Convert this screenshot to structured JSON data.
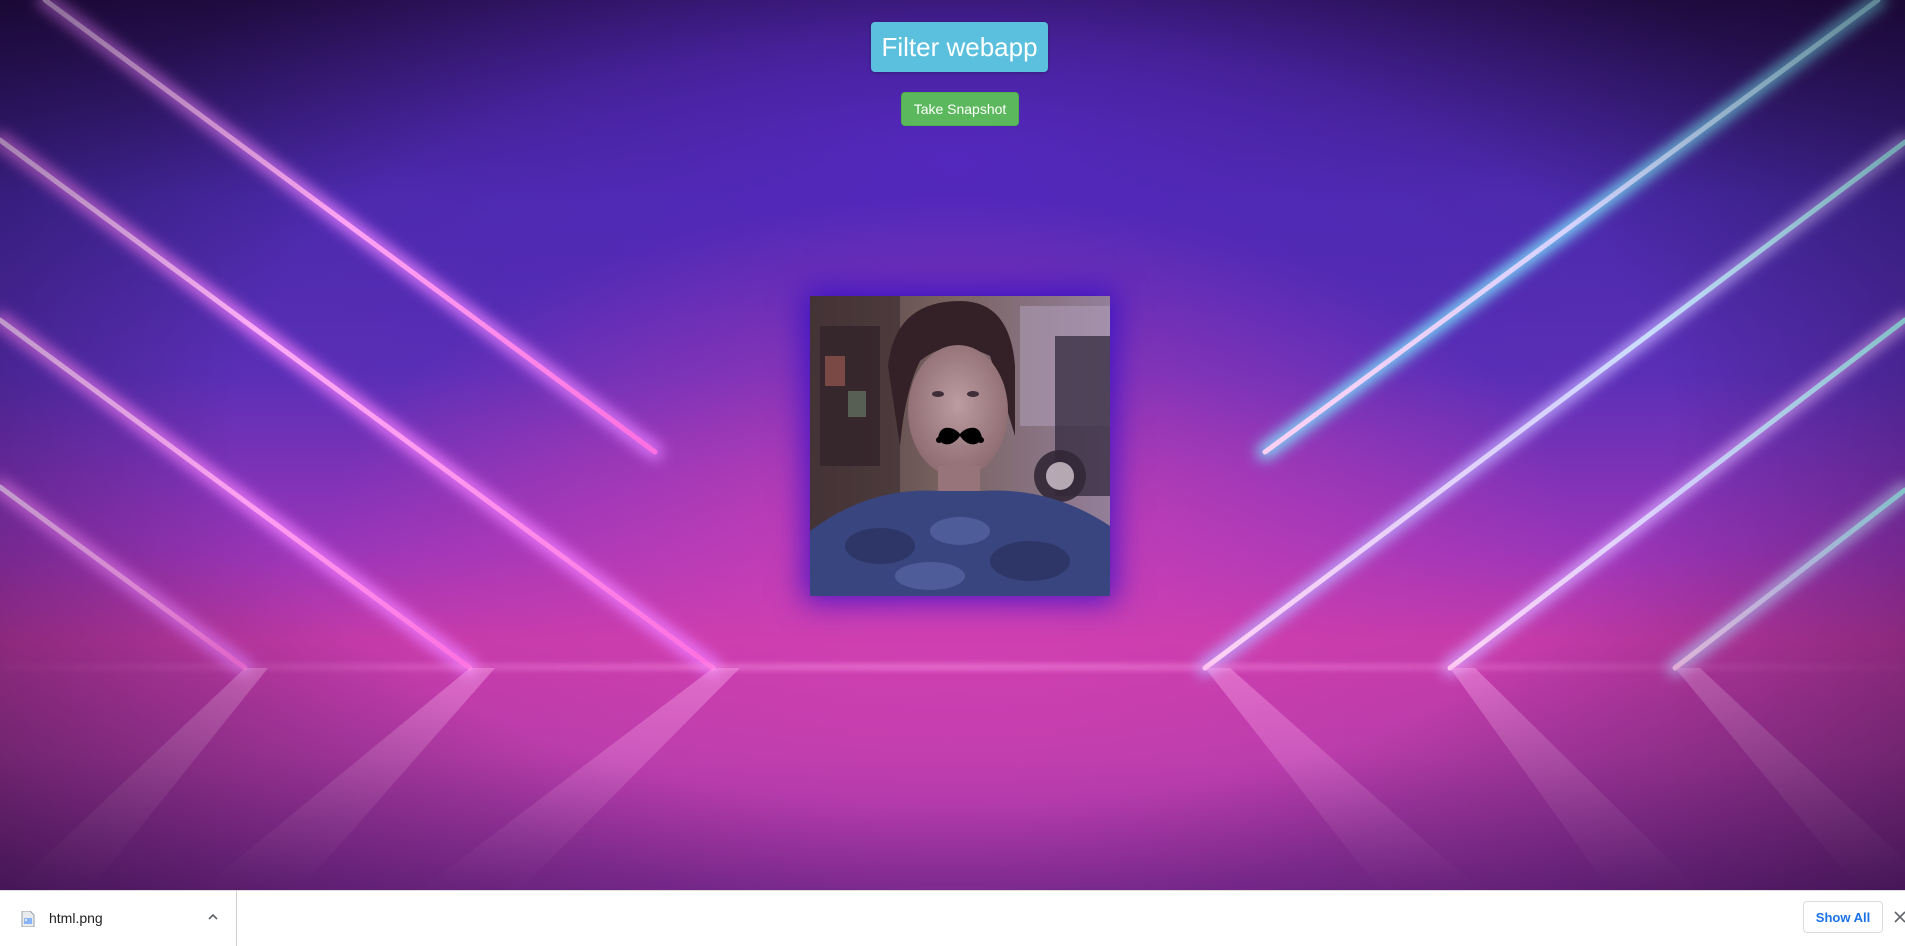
{
  "page": {
    "title_badge": "Filter webapp",
    "snapshot_button": "Take Snapshot"
  },
  "preview": {
    "filter": "mustache"
  },
  "download_bar": {
    "file_name": "html.png",
    "show_all_label": "Show All"
  },
  "icons": {
    "file": "image-file-icon",
    "expand": "chevron-up-icon",
    "close": "close-icon",
    "mustache": "mustache-icon"
  },
  "colors": {
    "title_badge": "#5bc0de",
    "snapshot_button": "#5cb85c",
    "show_all_text": "#1a73e8",
    "neon_pink": "#ff7fe6",
    "neon_cyan": "#8ff2ff"
  }
}
